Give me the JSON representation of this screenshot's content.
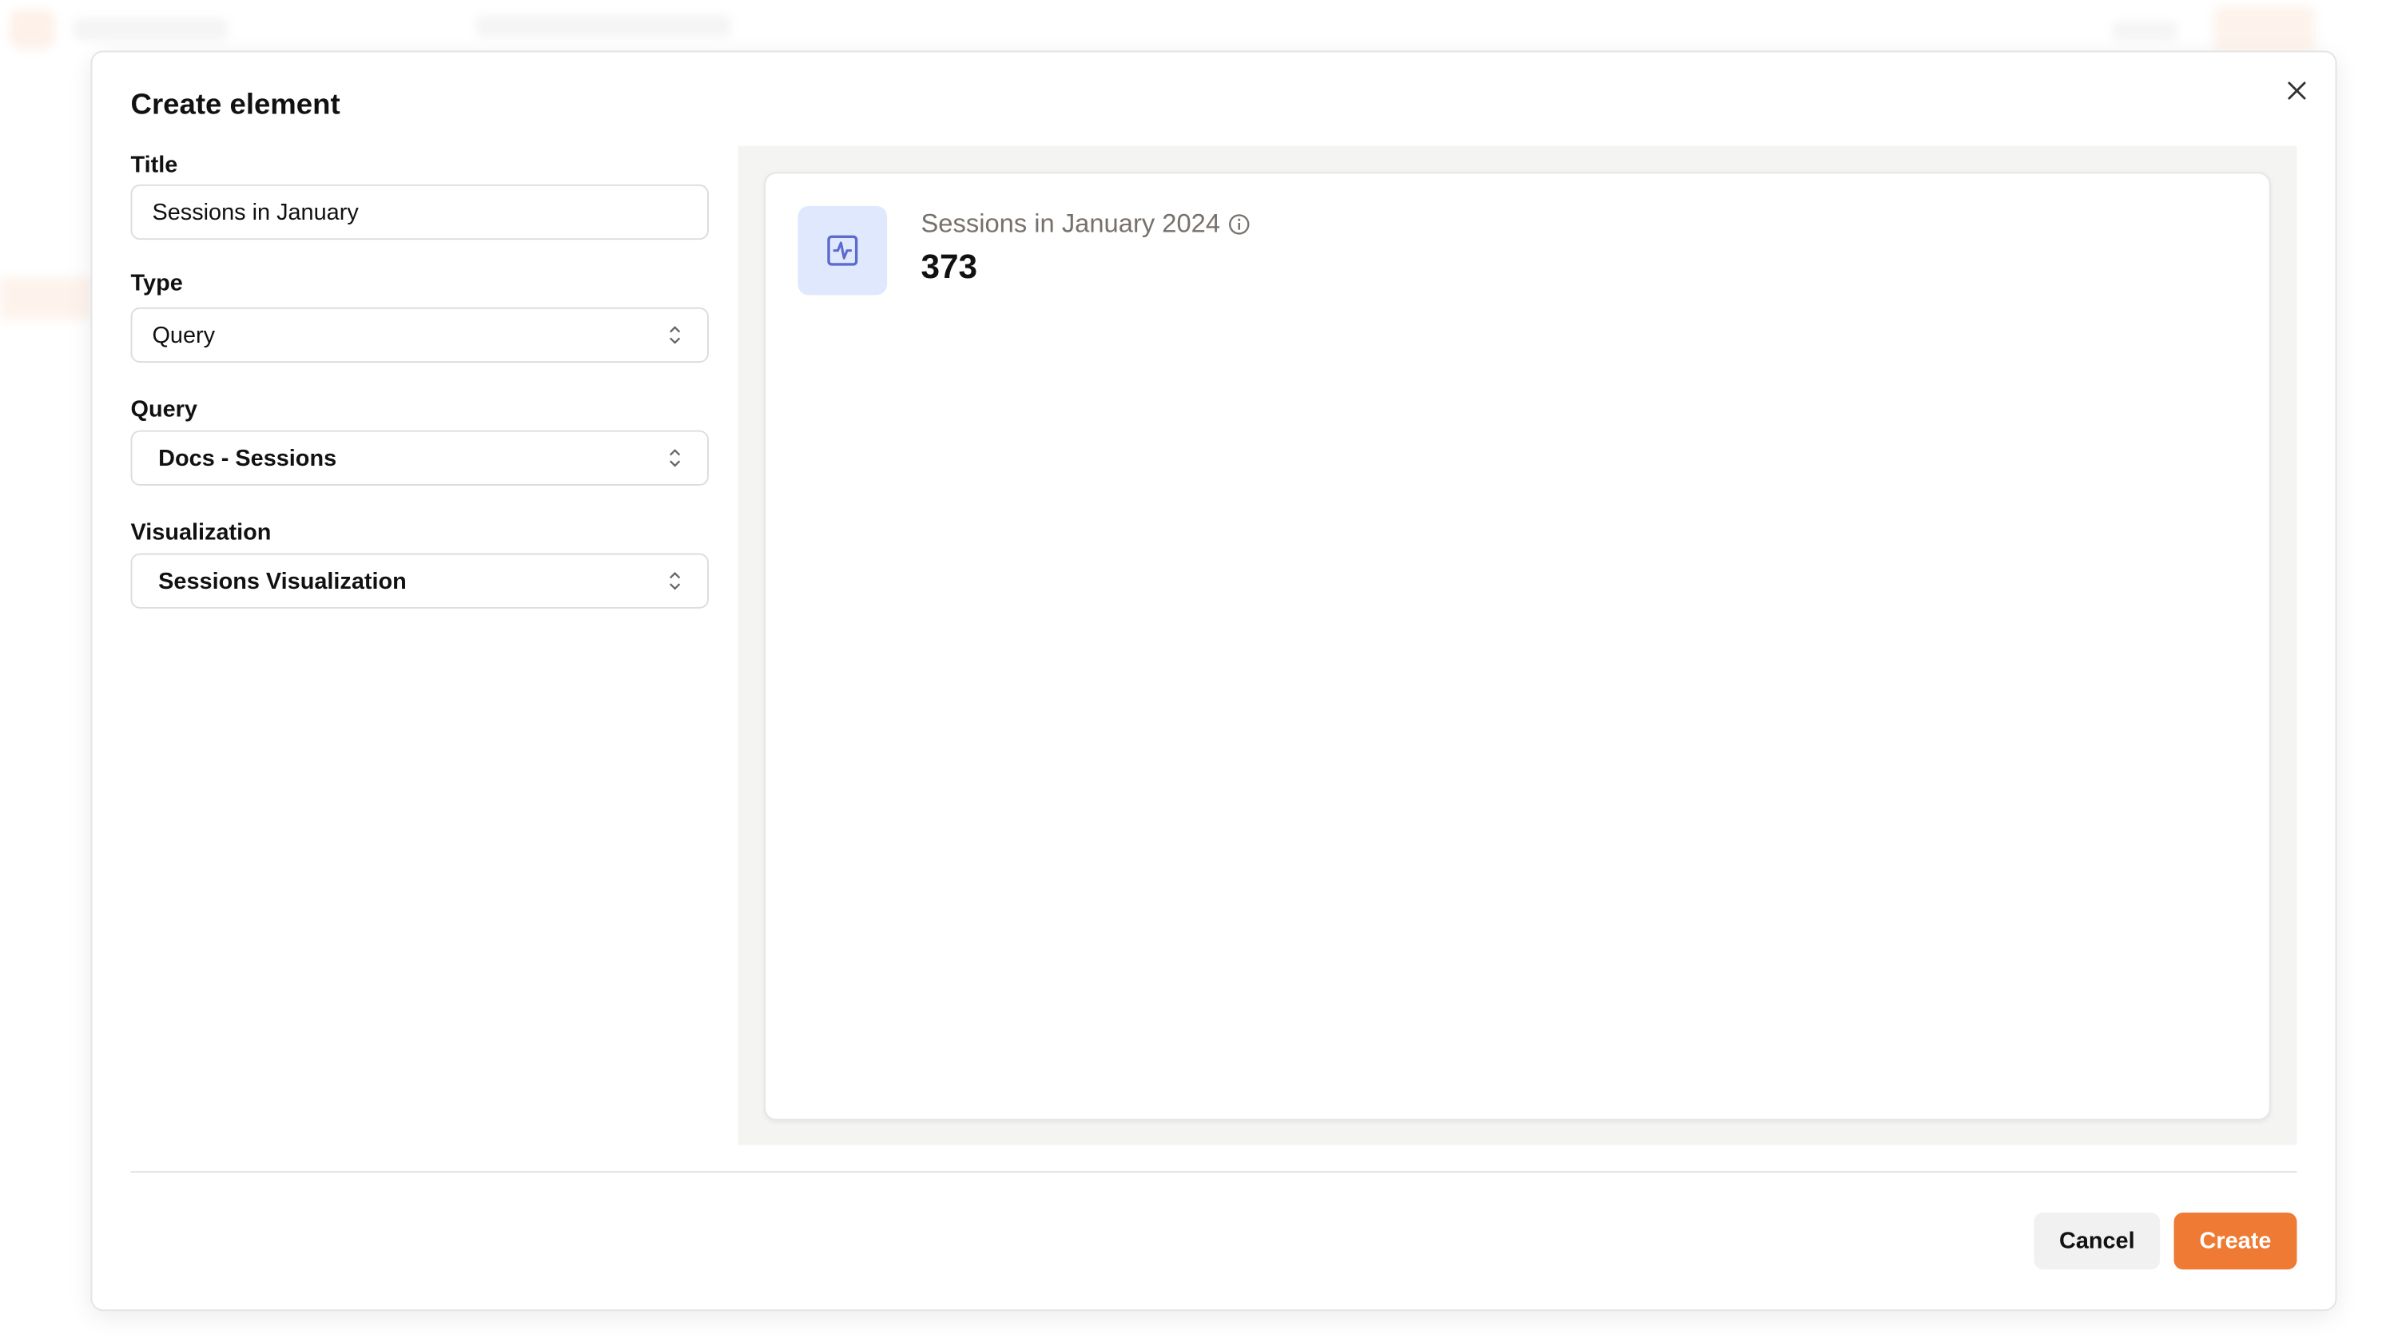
{
  "modal": {
    "title": "Create element",
    "close_icon": "close-icon",
    "fields": {
      "title_label": "Title",
      "title_value": "Sessions in January",
      "type_label": "Type",
      "type_value": "Query",
      "query_label": "Query",
      "query_value": "Docs - Sessions",
      "visualization_label": "Visualization",
      "visualization_value": "Sessions Visualization"
    },
    "preview": {
      "icon": "activity-chart-icon",
      "card_title": "Sessions in January 2024",
      "card_value": "373"
    },
    "buttons": {
      "cancel": "Cancel",
      "create": "Create"
    }
  },
  "colors": {
    "accent": "#ee7a33",
    "icon_bg": "#e0e8fd",
    "icon": "#5b6bd0"
  }
}
